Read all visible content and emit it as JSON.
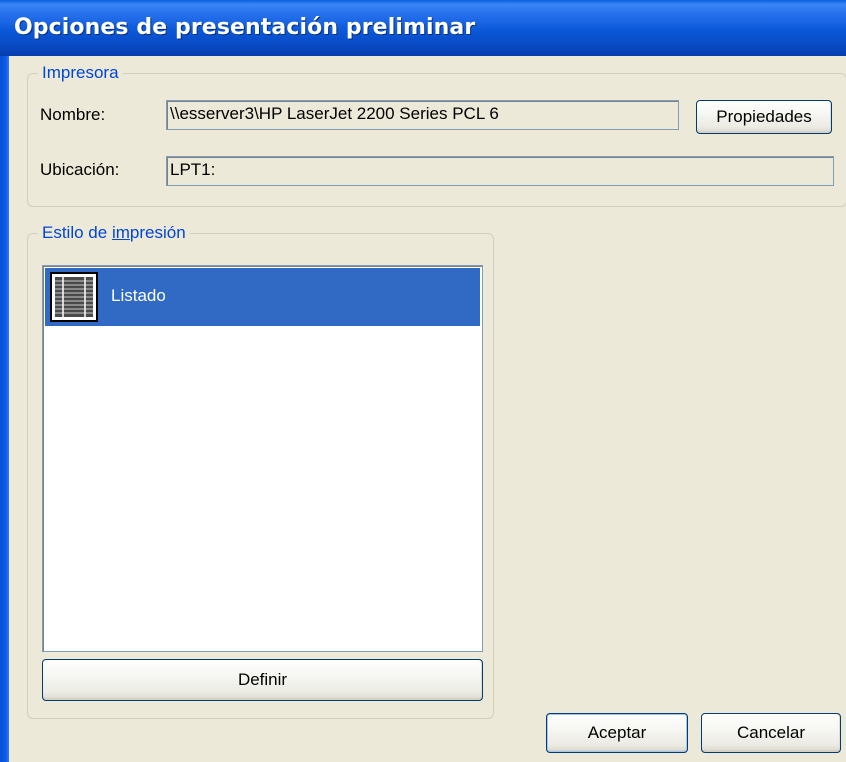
{
  "dialog": {
    "title": "Opciones de presentación preliminar"
  },
  "printer_group": {
    "legend": "Impresora",
    "name_label": "Nombre:",
    "name_value": "\\\\esserver3\\HP LaserJet 2200 Series PCL 6",
    "properties_button": "Propiedades",
    "location_label": "Ubicación:",
    "location_value": "LPT1:"
  },
  "print_style_group": {
    "legend_prefix": "Estilo de ",
    "legend_mnemonic": "im",
    "legend_suffix": "presión",
    "styles": [
      {
        "label": "Listado",
        "icon": "list-style-icon",
        "selected": true
      }
    ],
    "define_button": "Definir"
  },
  "footer": {
    "ok_button": "Aceptar",
    "cancel_button": "Cancelar"
  },
  "colors": {
    "title_bar": "#0a58d8",
    "group_label": "#0046d5",
    "selection": "#316ac5",
    "dialog_face": "#ece9d8"
  }
}
